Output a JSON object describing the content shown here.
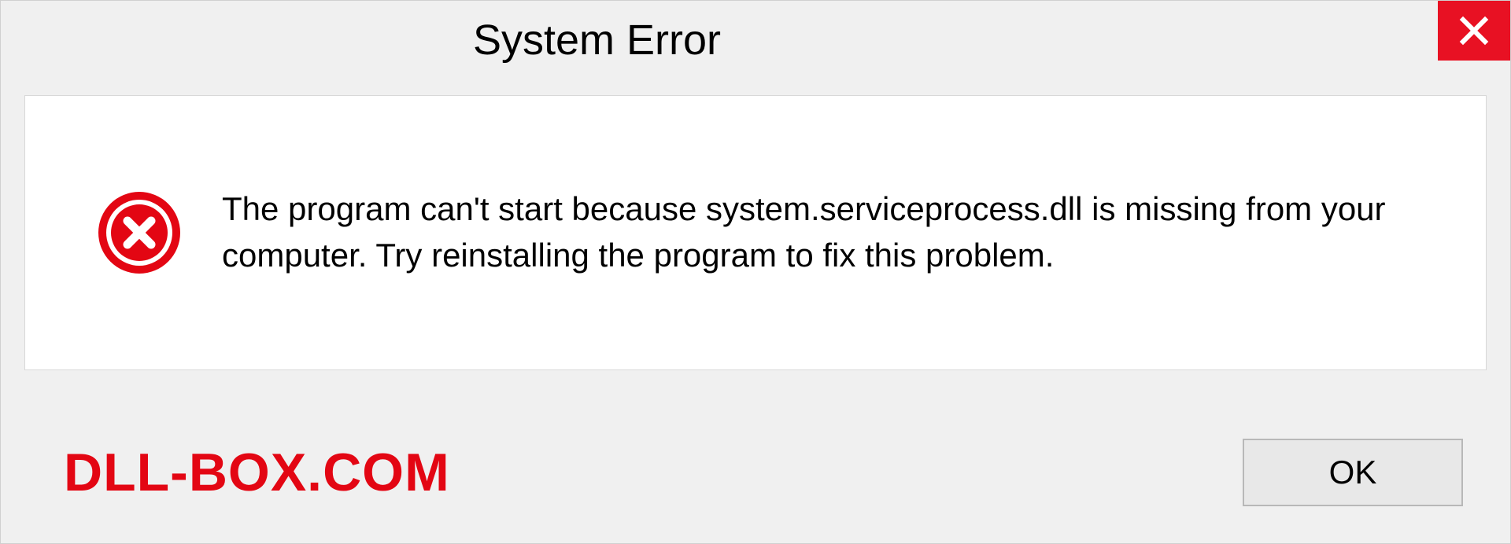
{
  "dialog": {
    "title": "System Error",
    "message": "The program can't start because system.serviceprocess.dll is missing from your computer. Try reinstalling the program to fix this problem.",
    "ok_label": "OK",
    "brand": "DLL-BOX.COM",
    "colors": {
      "close_bg": "#e81123",
      "error_icon": "#e30613",
      "brand": "#e30613"
    }
  }
}
